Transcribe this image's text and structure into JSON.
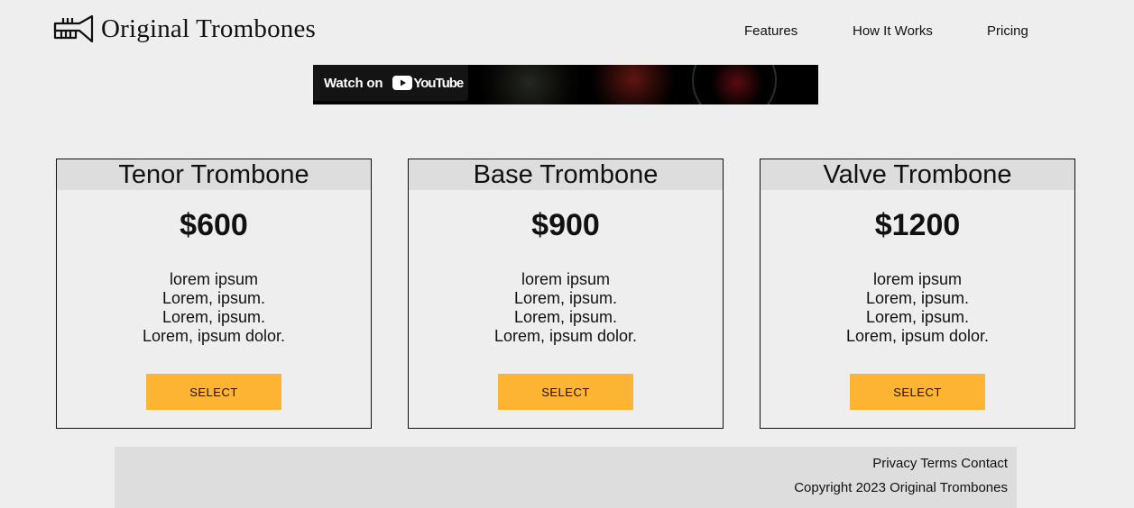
{
  "header": {
    "logo_text": "Original Trombones",
    "logo_icon": "trumpet-icon",
    "nav": [
      {
        "label": "Features"
      },
      {
        "label": "How It Works"
      },
      {
        "label": "Pricing"
      }
    ]
  },
  "video": {
    "watch_label": "Watch on",
    "brand": "YouTube",
    "icon": "youtube-play-icon"
  },
  "pricing": [
    {
      "title": "Tenor Trombone",
      "price": "$600",
      "features": [
        "lorem ipsum",
        "Lorem, ipsum.",
        "Lorem, ipsum.",
        "Lorem, ipsum dolor."
      ],
      "button": "SELECT"
    },
    {
      "title": "Base Trombone",
      "price": "$900",
      "features": [
        "lorem ipsum",
        "Lorem, ipsum.",
        "Lorem, ipsum.",
        "Lorem, ipsum dolor."
      ],
      "button": "SELECT"
    },
    {
      "title": "Valve Trombone",
      "price": "$1200",
      "features": [
        "lorem ipsum",
        "Lorem, ipsum.",
        "Lorem, ipsum.",
        "Lorem, ipsum dolor."
      ],
      "button": "SELECT"
    }
  ],
  "footer": {
    "links": [
      {
        "label": "Privacy"
      },
      {
        "label": "Terms"
      },
      {
        "label": "Contact"
      }
    ],
    "copyright": "Copyright 2023 Original Trombones"
  },
  "colors": {
    "background": "#eeeeee",
    "panel": "#dddddd",
    "accent": "#fdb433",
    "youtube_red": "#ff0000"
  }
}
